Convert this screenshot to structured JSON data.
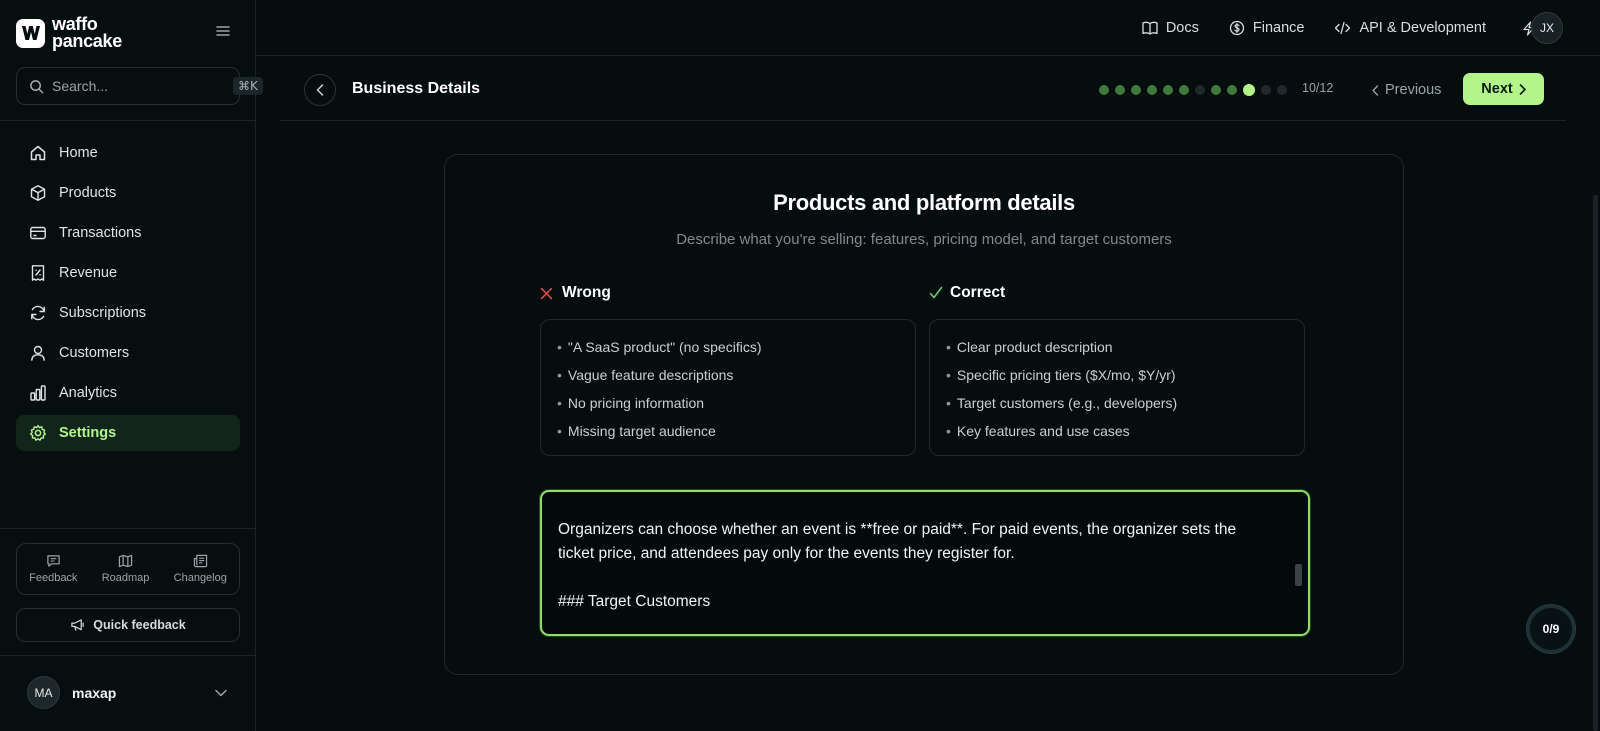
{
  "brand": {
    "line1": "waffo",
    "line2": "pancake"
  },
  "search": {
    "placeholder": "Search...",
    "shortcut": "⌘K"
  },
  "sidebar": {
    "items": [
      {
        "label": "Home",
        "icon": "home-icon"
      },
      {
        "label": "Products",
        "icon": "box-icon"
      },
      {
        "label": "Transactions",
        "icon": "credit-card-icon"
      },
      {
        "label": "Revenue",
        "icon": "receipt-icon"
      },
      {
        "label": "Subscriptions",
        "icon": "refresh-icon"
      },
      {
        "label": "Customers",
        "icon": "user-icon"
      },
      {
        "label": "Analytics",
        "icon": "bar-chart-icon"
      },
      {
        "label": "Settings",
        "icon": "gear-icon",
        "active": true
      }
    ],
    "tools": [
      {
        "label": "Feedback",
        "icon": "message-icon"
      },
      {
        "label": "Roadmap",
        "icon": "map-icon"
      },
      {
        "label": "Changelog",
        "icon": "newspaper-icon"
      }
    ],
    "quick_feedback": "Quick feedback"
  },
  "user": {
    "initials": "MA",
    "name": "maxap"
  },
  "topbar": {
    "links": [
      {
        "label": "Docs",
        "icon": "book-icon"
      },
      {
        "label": "Finance",
        "icon": "dollar-circle-icon"
      },
      {
        "label": "API & Development",
        "icon": "code-icon"
      }
    ],
    "avatar_initials": "JX"
  },
  "step": {
    "title": "Business Details",
    "current": 10,
    "total": 12,
    "counter_text": "10/12",
    "previous_label": "Previous",
    "next_label": "Next"
  },
  "card": {
    "title": "Products and platform details",
    "subtitle": "Describe what you're selling: features, pricing model, and target customers",
    "wrong": {
      "heading": "Wrong",
      "items": [
        "\"A SaaS product\" (no specifics)",
        "Vague feature descriptions",
        "No pricing information",
        "Missing target audience"
      ]
    },
    "correct": {
      "heading": "Correct",
      "items": [
        "Clear product description",
        "Specific pricing tiers ($X/mo, $Y/yr)",
        "Target customers (e.g., developers)",
        "Key features and use cases"
      ]
    },
    "editor_lines": [
      "Organizers can choose whether an event is **free or paid**. For paid events, the organizer sets the",
      "ticket price, and attendees pay only for the events they register for.",
      "",
      "### Target Customers"
    ]
  },
  "progress_badge": "0/9",
  "colors": {
    "accent": "#b2f58a",
    "wrong": "#e5534b",
    "correct": "#6fd36a",
    "background": "#060d0f"
  }
}
